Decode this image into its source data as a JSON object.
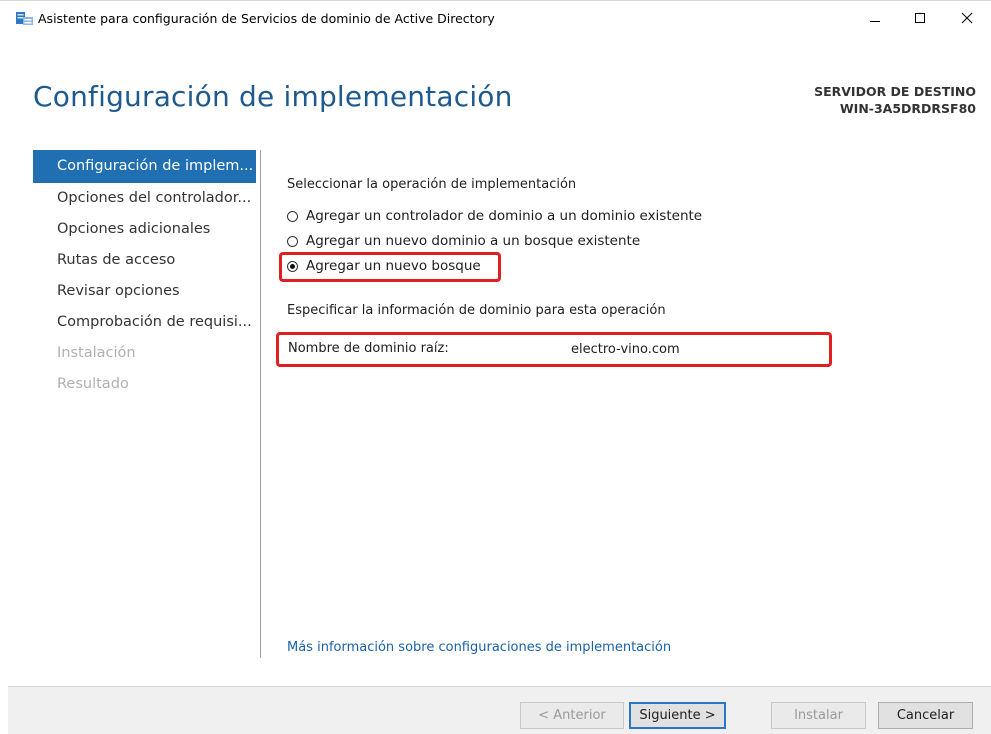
{
  "window": {
    "title": "Asistente para configuración de Servicios de dominio de Active Directory",
    "icon": "server-role-icon"
  },
  "header": {
    "page_title": "Configuración de implementación",
    "server_label": "SERVIDOR DE DESTINO",
    "server_name": "WIN-3A5DRDRSF80"
  },
  "nav": {
    "items": [
      {
        "label": "Configuración de implem...",
        "state": "active"
      },
      {
        "label": "Opciones del controlador...",
        "state": "normal"
      },
      {
        "label": "Opciones adicionales",
        "state": "normal"
      },
      {
        "label": "Rutas de acceso",
        "state": "normal"
      },
      {
        "label": "Revisar opciones",
        "state": "normal"
      },
      {
        "label": "Comprobación de requisi...",
        "state": "normal"
      },
      {
        "label": "Instalación",
        "state": "disabled"
      },
      {
        "label": "Resultado",
        "state": "disabled"
      }
    ]
  },
  "main": {
    "operation_heading": "Seleccionar la operación de implementación",
    "options": [
      {
        "label": "Agregar un controlador de dominio a un dominio existente",
        "checked": false
      },
      {
        "label": "Agregar un nuevo dominio a un bosque existente",
        "checked": false
      },
      {
        "label": "Agregar un nuevo bosque",
        "checked": true
      }
    ],
    "domain_heading": "Especificar la información de dominio para esta operación",
    "root_domain_label": "Nombre de dominio raíz:",
    "root_domain_value": "electro-vino.com",
    "more_info_link": "Más información sobre configuraciones de implementación"
  },
  "footer": {
    "back": "< Anterior",
    "next": "Siguiente >",
    "install": "Instalar",
    "cancel": "Cancelar"
  },
  "colors": {
    "title_blue": "#1f5a8e",
    "nav_active": "#1f6fb2",
    "highlight_red": "#e02020",
    "link_blue": "#1a62aa"
  }
}
